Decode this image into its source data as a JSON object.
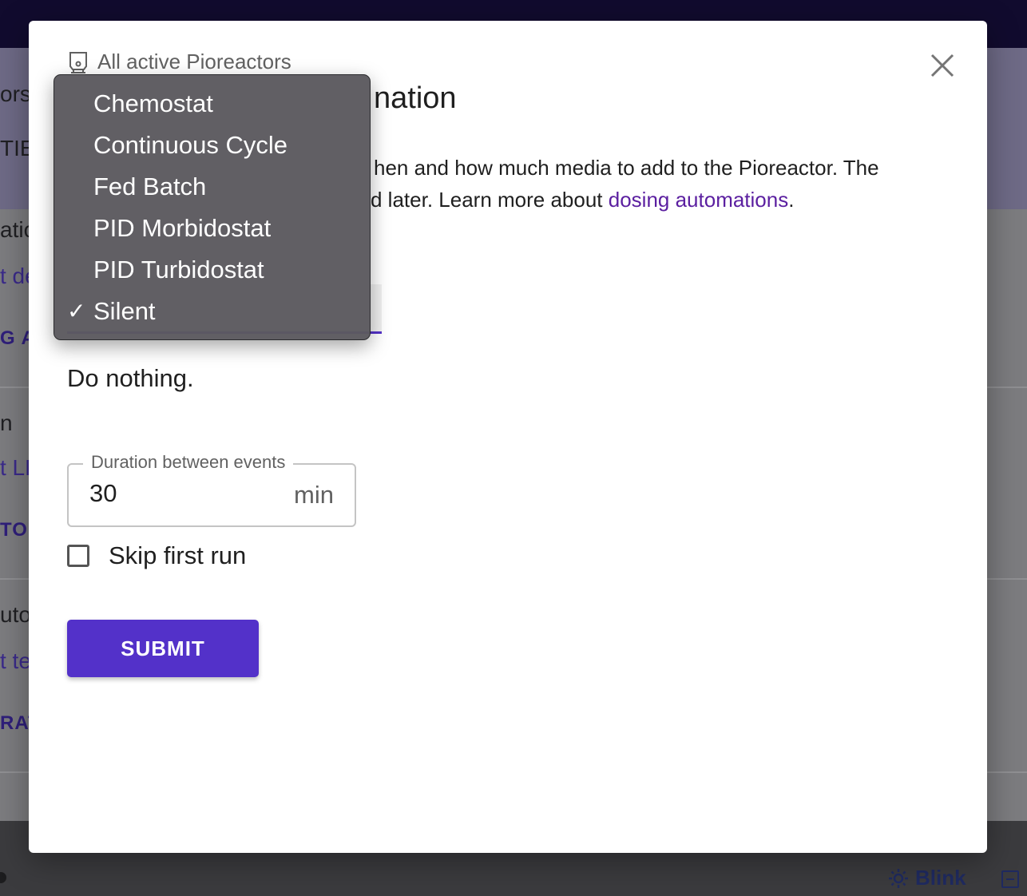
{
  "background": {
    "fragments": [
      "ors",
      "TIES",
      "atic",
      "t de",
      "G AU",
      "n",
      "t LE",
      "TO",
      "uto",
      "t te",
      "RAT"
    ],
    "blink_label": "Blink"
  },
  "dialog": {
    "subtitle": "All active Pioreactors",
    "title_visible": "nation",
    "description_visible": "hen and how much media to add to the Pioreactor. The",
    "description_line2": "d later. Learn more about ",
    "description_link": "dosing automations",
    "description_end": ".",
    "automation_description": "Do nothing.",
    "duration": {
      "label": "Duration between events",
      "value": "30",
      "unit": "min"
    },
    "skip_first_run_label": "Skip first run",
    "submit_label": "SUBMIT"
  },
  "dropdown": {
    "selected": "Silent",
    "options": [
      "Chemostat",
      "Continuous Cycle",
      "Fed Batch",
      "PID Morbidostat",
      "PID Turbidostat",
      "Silent"
    ],
    "check_glyph": "✓"
  },
  "colors": {
    "accent": "#5331c9",
    "link": "#5b1fa0",
    "menu_bg": "#5c5a5f"
  },
  "icons": {
    "subtitle": "pioreactor-icon",
    "close": "close-icon",
    "blink": "sun-icon",
    "collapse": "collapse-icon"
  }
}
